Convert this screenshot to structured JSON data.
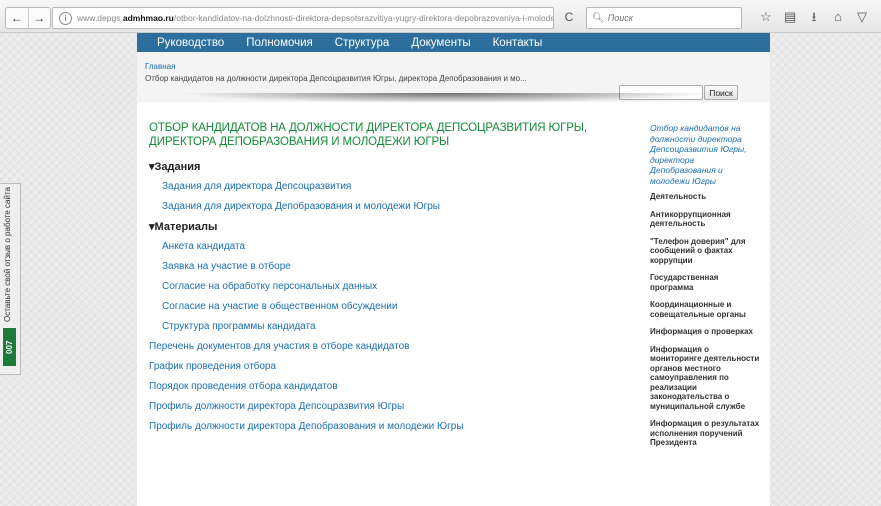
{
  "browser": {
    "nav_back": "←",
    "nav_forward": "→",
    "url_prefix": "www.depgs.",
    "url_domain": "admhmao.ru",
    "url_path": "/otbor-kandidatov-na-dolzhnosti-direktora-depsotsrazvitiya-yugry-direktora-depobrazovaniya-i-molodezh/",
    "reload": "C",
    "search_placeholder": "Поиск",
    "tool_icons": [
      "star-icon",
      "reading-list-icon",
      "download-icon",
      "home-icon",
      "pocket-icon"
    ]
  },
  "feedback": {
    "text": "Оставьте свой отзыв о работе сайта",
    "badge": "007"
  },
  "nav": [
    "Руководство",
    "Полномочия",
    "Структура",
    "Документы",
    "Контакты"
  ],
  "breadcrumb": {
    "home": "Главная",
    "current": "Отбор кандидатов на должности директора Депсоцразвития Югры, директора Депобразования и мо..."
  },
  "site_search": {
    "button": "Поиск"
  },
  "main": {
    "title": "Отбор кандидатов на должности директора Депсоцразвития Югры, директора Депобразования и молодежи Югры",
    "section1": "Задания",
    "section1_links": [
      "Задания для директора Депсоцразвития",
      "Задания для директора Депобразования и молодежи Югры"
    ],
    "section2": "Материалы",
    "section2_links": [
      "Анкета кандидата",
      "Заявка на участие в отборе",
      "Согласие на обработку персональных данных",
      "Согласие на участие в общественном обсуждении",
      "Структура программы кандидата"
    ],
    "links": [
      "Перечень документов для участия в отборе кандидатов",
      "График проведения отбора",
      "Порядок проведения отбора кандидатов",
      "Профиль должности директора Депсоцразвития Югры",
      "Профиль должности директора Депобразования и молодежи Югры"
    ]
  },
  "sidebar": {
    "title": "Отбор кандидатов на должности директора Депсоцразвития Югры, директора Депобразования и молодежи Югры",
    "items": [
      "Деятельность",
      "Антикоррупционная деятельность",
      "\"Телефон доверия\" для сообщений о фактах коррупции",
      "Государственная программа",
      "Координационные и совещательные органы",
      "Информация о проверках",
      "Информация о мониторинге деятельности органов местного самоуправления по реализации законодательства о муниципальной службе",
      "Информация о результатах исполнения поручений Президента"
    ]
  },
  "colors": {
    "nav_bg": "#2c6e9c",
    "title": "#148a3a",
    "link": "#1a6fb0",
    "badge": "#1d7b3a"
  }
}
